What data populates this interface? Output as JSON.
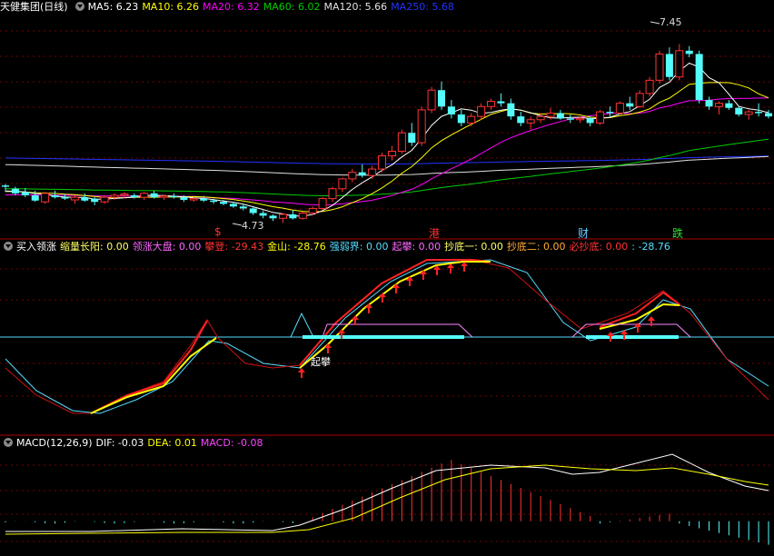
{
  "main": {
    "title": "天健集团(日线)",
    "ma": [
      {
        "label": "MA5: 6.23",
        "color": "#ffffff"
      },
      {
        "label": "MA10: 6.26",
        "color": "#ffff00"
      },
      {
        "label": "MA20: 6.32",
        "color": "#ff00ff"
      },
      {
        "label": "MA60: 6.02",
        "color": "#00cc00"
      },
      {
        "label": "MA120: 5.66",
        "color": "#e0e0e0"
      },
      {
        "label": "MA250: 5.68",
        "color": "#2233ff"
      }
    ],
    "price_high": "7.45",
    "price_low": "4.73",
    "signals": [
      {
        "text": "$",
        "color": "#ff3333"
      },
      {
        "text": "港",
        "color": "#ff3333"
      },
      {
        "text": "财",
        "color": "#66ccff"
      },
      {
        "text": "跌",
        "color": "#33dd33"
      }
    ]
  },
  "ind": {
    "name": "买入领涨",
    "items": [
      {
        "label": "缩量长阳: 0.00",
        "color": "#ffff66"
      },
      {
        "label": "领涨大盘: 0.00",
        "color": "#ff66ff"
      },
      {
        "label": "攀登: -29.43",
        "color": "#ff3333"
      },
      {
        "label": "金山: -28.76",
        "color": "#ffff00"
      },
      {
        "label": "强弱界: 0.00",
        "color": "#55ddff"
      },
      {
        "label": "起攀: 0.00",
        "color": "#ff66ff"
      },
      {
        "label": "抄底一: 0.00",
        "color": "#ffff66"
      },
      {
        "label": "抄底二: 0.00",
        "color": "#ffaa33"
      },
      {
        "label": "必抄底: 0.00",
        "color": "#ff3333"
      },
      {
        "label": ": -28.76",
        "color": "#55ddff"
      }
    ],
    "mark": "起攀"
  },
  "macd": {
    "name": "MACD(12,26,9)",
    "items": [
      {
        "label": "DIF: -0.03",
        "color": "#ffffff"
      },
      {
        "label": "DEA: 0.01",
        "color": "#ffff00"
      },
      {
        "label": "MACD: -0.08",
        "color": "#ff44ff"
      }
    ]
  },
  "colors": {
    "up": "#ff3333",
    "down": "#54fcfc"
  },
  "chart_data": {
    "type": "candlestick",
    "candles": [
      [
        5.3,
        5.32,
        5.2,
        5.28
      ],
      [
        5.25,
        5.28,
        5.15,
        5.18
      ],
      [
        5.2,
        5.26,
        5.12,
        5.15
      ],
      [
        5.15,
        5.22,
        5.05,
        5.07
      ],
      [
        5.05,
        5.2,
        5.02,
        5.18
      ],
      [
        5.15,
        5.22,
        5.1,
        5.12
      ],
      [
        5.12,
        5.17,
        5.08,
        5.1
      ],
      [
        5.08,
        5.15,
        5.02,
        5.12
      ],
      [
        5.12,
        5.18,
        5.05,
        5.07
      ],
      [
        5.1,
        5.12,
        5.0,
        5.05
      ],
      [
        5.05,
        5.15,
        5.02,
        5.12
      ],
      [
        5.12,
        5.18,
        5.08,
        5.15
      ],
      [
        5.15,
        5.2,
        5.1,
        5.17
      ],
      [
        5.15,
        5.18,
        5.1,
        5.12
      ],
      [
        5.12,
        5.2,
        5.08,
        5.18
      ],
      [
        5.18,
        5.22,
        5.1,
        5.12
      ],
      [
        5.12,
        5.16,
        5.08,
        5.14
      ],
      [
        5.14,
        5.18,
        5.1,
        5.12
      ],
      [
        5.12,
        5.15,
        5.05,
        5.08
      ],
      [
        5.08,
        5.12,
        5.05,
        5.1
      ],
      [
        5.1,
        5.14,
        5.05,
        5.07
      ],
      [
        5.07,
        5.1,
        5.02,
        5.05
      ],
      [
        5.05,
        5.08,
        5.0,
        5.02
      ],
      [
        5.02,
        5.05,
        4.96,
        4.98
      ],
      [
        4.98,
        5.02,
        4.92,
        4.95
      ],
      [
        4.95,
        4.98,
        4.85,
        4.88
      ],
      [
        4.88,
        4.92,
        4.8,
        4.84
      ],
      [
        4.84,
        4.86,
        4.76,
        4.8
      ],
      [
        4.8,
        4.88,
        4.73,
        4.86
      ],
      [
        4.86,
        4.92,
        4.78,
        4.8
      ],
      [
        4.8,
        4.9,
        4.78,
        4.88
      ],
      [
        4.88,
        4.98,
        4.85,
        4.95
      ],
      [
        4.95,
        5.12,
        4.92,
        5.1
      ],
      [
        5.1,
        5.28,
        5.05,
        5.25
      ],
      [
        5.25,
        5.42,
        5.2,
        5.4
      ],
      [
        5.4,
        5.55,
        5.35,
        5.5
      ],
      [
        5.5,
        5.62,
        5.42,
        5.45
      ],
      [
        5.45,
        5.6,
        5.4,
        5.55
      ],
      [
        5.55,
        5.8,
        5.5,
        5.75
      ],
      [
        5.75,
        5.9,
        5.68,
        5.82
      ],
      [
        5.82,
        6.15,
        5.78,
        6.1
      ],
      [
        6.1,
        6.25,
        5.9,
        5.95
      ],
      [
        5.95,
        6.5,
        5.9,
        6.45
      ],
      [
        6.45,
        6.8,
        6.4,
        6.75
      ],
      [
        6.75,
        6.88,
        6.45,
        6.5
      ],
      [
        6.5,
        6.6,
        6.32,
        6.38
      ],
      [
        6.38,
        6.45,
        6.2,
        6.25
      ],
      [
        6.25,
        6.4,
        6.2,
        6.35
      ],
      [
        6.35,
        6.55,
        6.3,
        6.5
      ],
      [
        6.5,
        6.62,
        6.45,
        6.58
      ],
      [
        6.58,
        6.7,
        6.5,
        6.55
      ],
      [
        6.55,
        6.62,
        6.3,
        6.35
      ],
      [
        6.35,
        6.42,
        6.2,
        6.25
      ],
      [
        6.25,
        6.35,
        6.15,
        6.3
      ],
      [
        6.3,
        6.4,
        6.25,
        6.35
      ],
      [
        6.35,
        6.48,
        6.3,
        6.4
      ],
      [
        6.4,
        6.45,
        6.3,
        6.32
      ],
      [
        6.32,
        6.38,
        6.25,
        6.3
      ],
      [
        6.3,
        6.35,
        6.25,
        6.32
      ],
      [
        6.32,
        6.35,
        6.2,
        6.25
      ],
      [
        6.25,
        6.45,
        6.22,
        6.42
      ],
      [
        6.42,
        6.5,
        6.35,
        6.4
      ],
      [
        6.4,
        6.58,
        6.38,
        6.55
      ],
      [
        6.55,
        6.65,
        6.45,
        6.5
      ],
      [
        6.5,
        6.75,
        6.48,
        6.7
      ],
      [
        6.7,
        6.95,
        6.65,
        6.9
      ],
      [
        6.9,
        7.35,
        6.85,
        7.3
      ],
      [
        7.3,
        7.4,
        6.9,
        6.95
      ],
      [
        6.95,
        7.45,
        6.9,
        7.35
      ],
      [
        7.35,
        7.42,
        7.25,
        7.3
      ],
      [
        7.3,
        7.35,
        6.55,
        6.6
      ],
      [
        6.6,
        6.65,
        6.45,
        6.5
      ],
      [
        6.5,
        6.58,
        6.38,
        6.55
      ],
      [
        6.55,
        6.6,
        6.45,
        6.48
      ],
      [
        6.48,
        6.5,
        6.35,
        6.38
      ],
      [
        6.38,
        6.45,
        6.3,
        6.42
      ],
      [
        6.42,
        6.55,
        6.35,
        6.4
      ],
      [
        6.4,
        6.45,
        6.32,
        6.35
      ]
    ],
    "ylim": [
      4.5,
      7.9
    ],
    "macd_ylim": [
      -0.28,
      0.6
    ]
  }
}
